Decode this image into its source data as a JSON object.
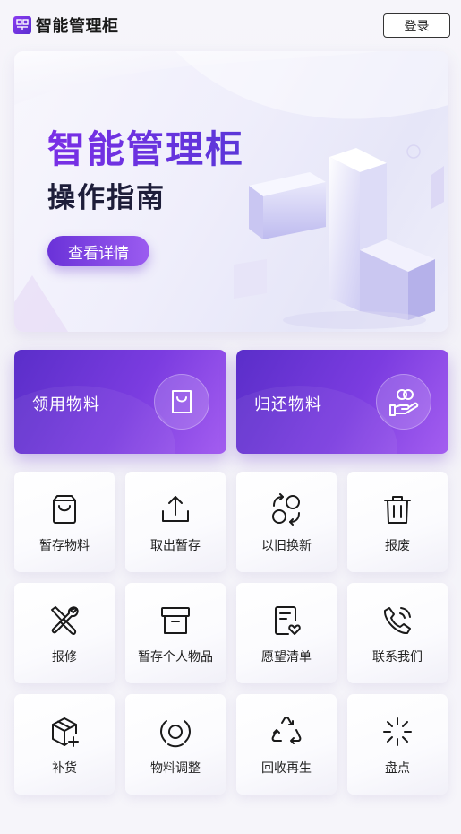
{
  "header": {
    "logo_icon": "cabinet-logo-icon",
    "app_name": "智能管理柜",
    "login_label": "登录"
  },
  "banner": {
    "title": "智能管理柜",
    "subtitle": "操作指南",
    "button_label": "查看详情"
  },
  "primary_actions": [
    {
      "label": "领用物料",
      "icon": "shopping-bag-icon"
    },
    {
      "label": "归还物料",
      "icon": "hand-coins-icon"
    }
  ],
  "grid": [
    {
      "label": "暂存物料",
      "icon": "bag-icon"
    },
    {
      "label": "取出暂存",
      "icon": "upload-icon"
    },
    {
      "label": "以旧换新",
      "icon": "exchange-icon"
    },
    {
      "label": "报废",
      "icon": "trash-icon"
    },
    {
      "label": "报修",
      "icon": "wrench-screwdriver-icon"
    },
    {
      "label": "暂存个人物品",
      "icon": "archive-box-icon"
    },
    {
      "label": "愿望清单",
      "icon": "wishlist-icon"
    },
    {
      "label": "联系我们",
      "icon": "phone-call-icon"
    },
    {
      "label": "补货",
      "icon": "package-add-icon"
    },
    {
      "label": "物料调整",
      "icon": "adjust-target-icon"
    },
    {
      "label": "回收再生",
      "icon": "recycle-icon"
    },
    {
      "label": "盘点",
      "icon": "loading-burst-icon"
    }
  ],
  "colors": {
    "accent": "#6b2fe0",
    "accent_light": "#a45ef0",
    "title_dark": "#1e1e3a"
  }
}
